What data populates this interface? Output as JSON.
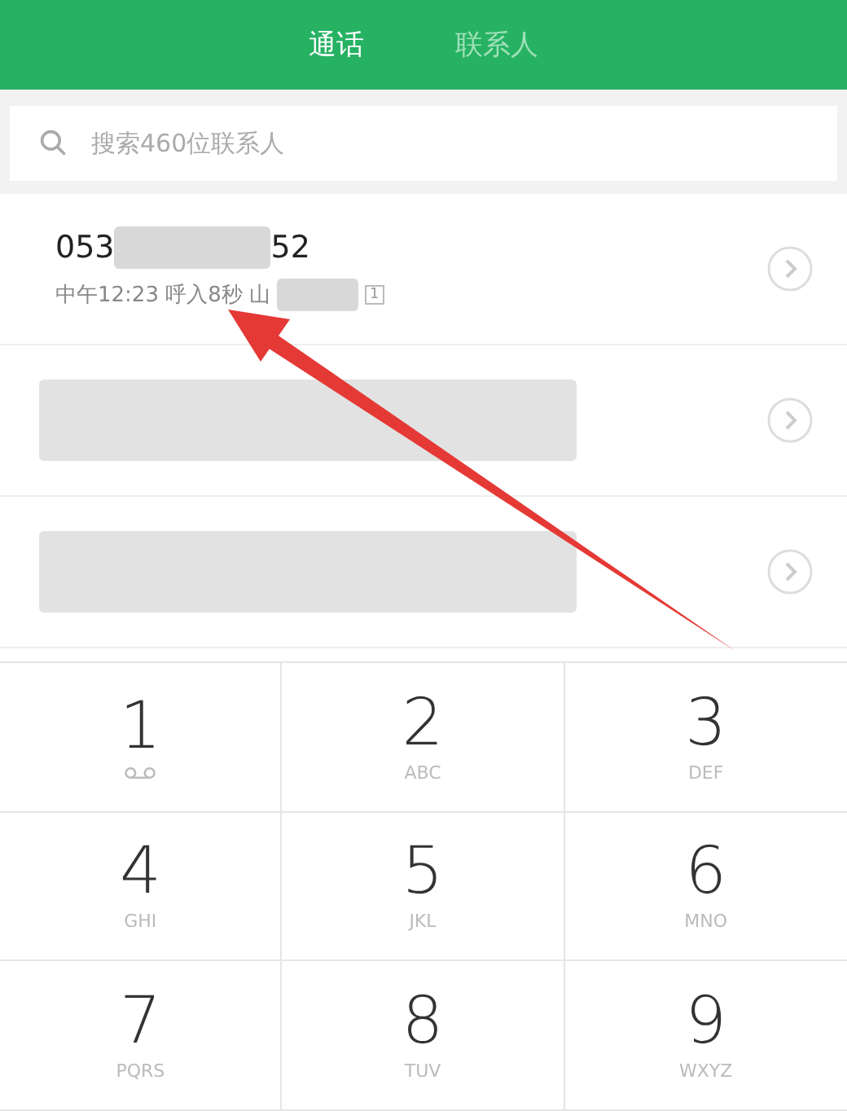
{
  "tabs": [
    {
      "label": "通话",
      "selected": true
    },
    {
      "label": "联系人",
      "selected": false
    }
  ],
  "search": {
    "placeholder": "搜索460位联系人"
  },
  "calls": [
    {
      "kind": "visible",
      "number_start": "053",
      "number_end": "52",
      "detail": "中午12:23 呼入8秒 山",
      "sim": "1"
    },
    {
      "kind": "redacted"
    },
    {
      "kind": "redacted"
    }
  ],
  "keypad": [
    {
      "digit": "1",
      "voicemail": true
    },
    {
      "digit": "2",
      "letters": "ABC",
      "voicemail": false
    },
    {
      "digit": "3",
      "letters": "DEF",
      "voicemail": false
    },
    {
      "digit": "4",
      "letters": "GHI",
      "voicemail": false
    },
    {
      "digit": "5",
      "letters": "JKL",
      "voicemail": false
    },
    {
      "digit": "6",
      "letters": "MNO",
      "voicemail": false
    },
    {
      "digit": "7",
      "letters": "PQRS",
      "voicemail": false
    },
    {
      "digit": "8",
      "letters": "TUV",
      "voicemail": false
    },
    {
      "digit": "9",
      "letters": "WXYZ",
      "voicemail": false
    }
  ]
}
